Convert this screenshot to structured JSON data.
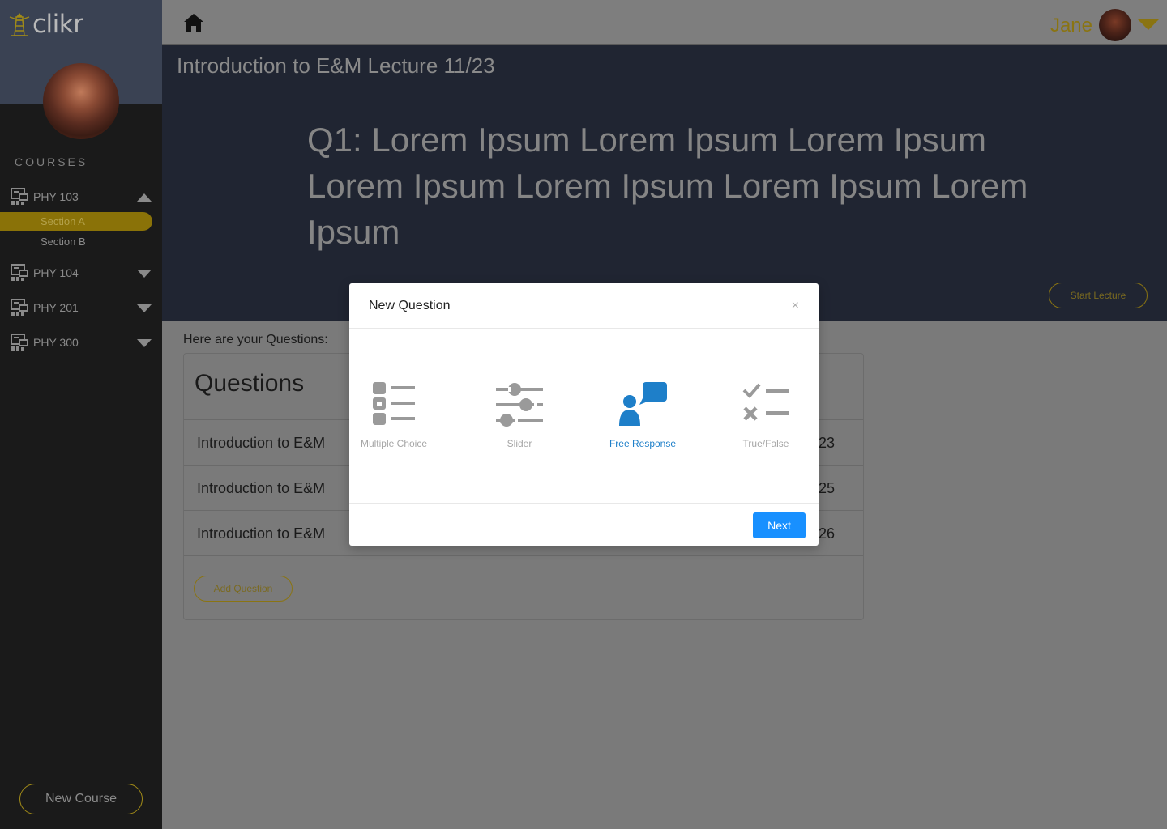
{
  "app": {
    "name": "clikr"
  },
  "colors": {
    "accent": "#8a7412",
    "sidebar_bg": "#1a1a1a",
    "header_bg": "#202532",
    "primary": "#1890ff",
    "selected_option": "#1e7fc9"
  },
  "sidebar": {
    "courses_label": "COURSES",
    "courses": [
      {
        "label": "PHY 103",
        "expanded": true,
        "sections": [
          "Section A",
          "Section B"
        ]
      },
      {
        "label": "PHY 104",
        "expanded": false
      },
      {
        "label": "PHY 201",
        "expanded": false
      },
      {
        "label": "PHY 300",
        "expanded": false
      }
    ],
    "active_section": "Section A",
    "new_course_label": "New Course"
  },
  "topbar": {
    "user_name": "Jane"
  },
  "header": {
    "lecture_title": "Introduction to E&M Lecture 11/23",
    "question_text": "Q1: Lorem Ipsum Lorem Ipsum Lorem Ipsum Lorem Ipsum Lorem Ipsum Lorem Ipsum Lorem Ipsum",
    "start_lecture_label": "Start Lecture"
  },
  "content": {
    "intro_label": "Here are your Questions:",
    "card_title": "Questions",
    "rows": [
      {
        "name": "Introduction to E&M",
        "date_fragment": "/23"
      },
      {
        "name": "Introduction to E&M",
        "date_fragment": "/25"
      },
      {
        "name": "Introduction to E&M",
        "date_fragment": "/26"
      }
    ],
    "add_question_label": "Add Question"
  },
  "modal": {
    "title": "New Question",
    "close_glyph": "×",
    "options": [
      {
        "label": "Multiple Choice",
        "icon": "list-icon",
        "selected": false
      },
      {
        "label": "Slider",
        "icon": "sliders-icon",
        "selected": false
      },
      {
        "label": "Free Response",
        "icon": "free-response-icon",
        "selected": true
      },
      {
        "label": "True/False",
        "icon": "true-false-icon",
        "selected": false
      }
    ],
    "next_label": "Next"
  }
}
